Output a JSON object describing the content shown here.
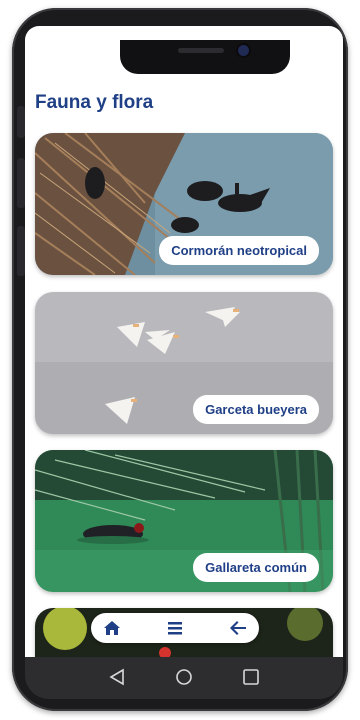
{
  "page": {
    "title": "Fauna y flora"
  },
  "cards": [
    {
      "label": "Cormorán neotropical"
    },
    {
      "label": "Garceta bueyera"
    },
    {
      "label": "Gallareta común"
    },
    {
      "label": ""
    }
  ],
  "nav": {
    "icons": [
      "home-icon",
      "menu-icon",
      "arrow-left-icon"
    ]
  },
  "system_bar": {
    "icons": [
      "back-triangle-icon",
      "home-circle-icon",
      "recent-apps-square-icon"
    ]
  },
  "colors": {
    "title": "#1f3f86",
    "label_text": "#1f3f86",
    "frame": "#1b1b1e",
    "system_bar": "#2d2d30"
  }
}
